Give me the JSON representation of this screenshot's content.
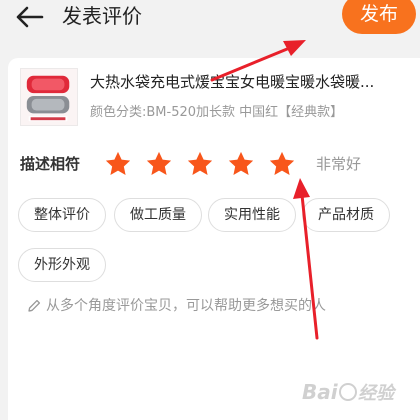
{
  "header": {
    "title": "发表评价",
    "publish_label": "发布"
  },
  "product": {
    "title": "大热水袋充电式煖宝宝女电暖宝暖水袋暖...",
    "variant": "颜色分类:BM-520加长款 中国红【经典款】"
  },
  "rating": {
    "label": "描述相符",
    "stars_filled": 5,
    "stars_total": 5,
    "text": "非常好",
    "star_color": "#f8561b"
  },
  "tags": [
    "整体评价",
    "做工质量",
    "实用性能",
    "产品材质",
    "外形外观"
  ],
  "hint": "从多个角度评价宝贝，可以帮助更多想买的人",
  "colors": {
    "accent": "#f8721e",
    "annotation_arrow": "#e8202a"
  },
  "icons": {
    "back": "arrow-left-icon",
    "star": "star-icon",
    "hint": "pencil-icon"
  }
}
